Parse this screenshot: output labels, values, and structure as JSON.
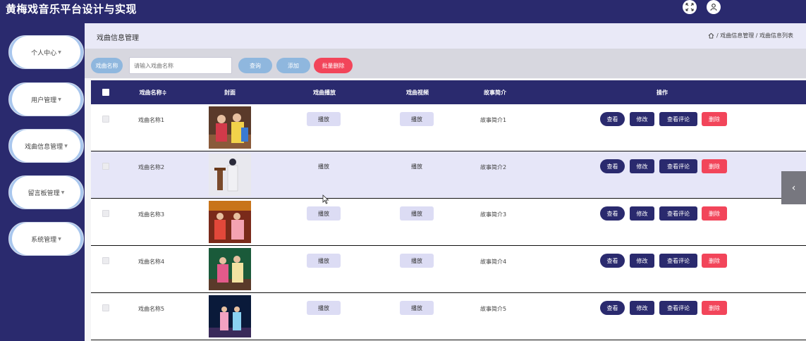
{
  "app": {
    "title": "黄梅戏音乐平台设计与实现"
  },
  "topbar": {
    "icons": [
      "fullscreen-icon",
      "user-icon"
    ]
  },
  "sidebar": {
    "items": [
      {
        "label": "个人中心"
      },
      {
        "label": "用户管理"
      },
      {
        "label": "戏曲信息管理"
      },
      {
        "label": "留言板管理"
      },
      {
        "label": "系统管理"
      }
    ]
  },
  "breadcrumb": {
    "title": "戏曲信息管理",
    "path": "/ 戏曲信息管理 / 戏曲信息列表"
  },
  "search": {
    "label": "戏曲名称",
    "placeholder": "请输入戏曲名称",
    "query_label": "查询",
    "add_label": "添加",
    "batch_delete_label": "批量删除"
  },
  "table": {
    "headers": [
      "戏曲名称≑",
      "封面",
      "戏曲播放",
      "戏曲视频",
      "故事简介",
      "操作"
    ],
    "rows": [
      {
        "name": "戏曲名称1",
        "play": "播放",
        "video": "播放",
        "intro": "故事简介1"
      },
      {
        "name": "戏曲名称2",
        "play": "播放",
        "video": "播放",
        "intro": "故事简介2"
      },
      {
        "name": "戏曲名称3",
        "play": "播放",
        "video": "播放",
        "intro": "故事简介3"
      },
      {
        "name": "戏曲名称4",
        "play": "播放",
        "video": "播放",
        "intro": "故事简介4"
      },
      {
        "name": "戏曲名称5",
        "play": "播放",
        "video": "播放",
        "intro": "故事简介5"
      }
    ],
    "actions": {
      "view": "查看",
      "edit": "修改",
      "comments": "查看评论",
      "delete": "删除"
    }
  },
  "colors": {
    "primary": "#2a2a6e",
    "danger": "#f2455a",
    "accent": "#8fb7de"
  }
}
